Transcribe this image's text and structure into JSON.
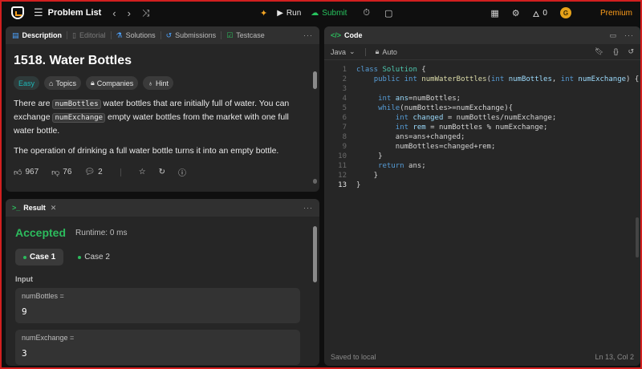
{
  "topbar": {
    "problem_list": "Problem List",
    "run": "Run",
    "submit": "Submit",
    "streak": "0",
    "premium": "Premium",
    "avatar_letter": "G"
  },
  "description": {
    "tabs": [
      "Description",
      "Editorial",
      "Solutions",
      "Submissions",
      "Testcase"
    ],
    "title": "1518. Water Bottles",
    "chips": [
      "Easy",
      "Topics",
      "Companies",
      "Hint"
    ],
    "para1_a": "There are ",
    "para1_code1": "numBottles",
    "para1_b": " water bottles that are initially full of water. You can exchange ",
    "para1_code2": "numExchange",
    "para1_c": " empty water bottles from the market with one full water bottle.",
    "para2": "The operation of drinking a full water bottle turns it into an empty bottle.",
    "likes": "967",
    "dislikes": "76",
    "comments": "2"
  },
  "result": {
    "tab": "Result",
    "status": "Accepted",
    "runtime": "Runtime: 0 ms",
    "cases": [
      "Case 1",
      "Case 2"
    ],
    "input_label": "Input",
    "inputs": [
      {
        "name": "numBottles =",
        "value": "9"
      },
      {
        "name": "numExchange =",
        "value": "3"
      }
    ]
  },
  "code": {
    "tab": "Code",
    "language": "Java",
    "mode": "Auto",
    "saved": "Saved to local",
    "cursor": "Ln 13, Col 2",
    "line_numbers": [
      "1",
      "2",
      "3",
      "4",
      "5",
      "6",
      "7",
      "8",
      "9",
      "10",
      "11",
      "12",
      "13"
    ]
  },
  "colors": {
    "accent_green": "#2cbb5d",
    "premium_orange": "#ff9e1b",
    "easy_teal": "#1cb8b8"
  }
}
